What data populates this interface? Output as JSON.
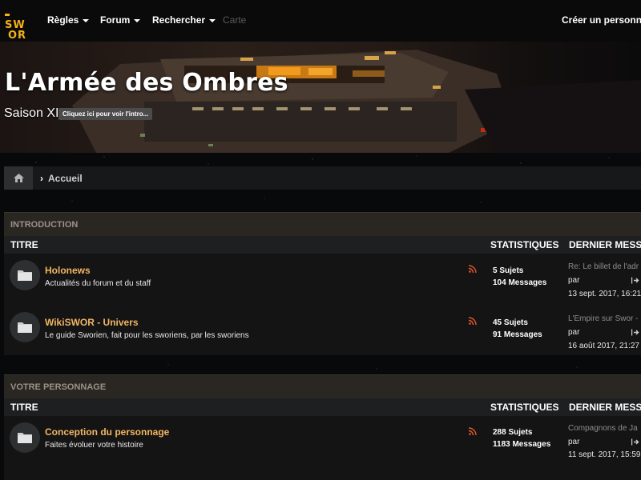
{
  "navbar": {
    "logo_line1": "SW",
    "logo_line2": "OR",
    "items": [
      {
        "label": "Règles"
      },
      {
        "label": "Forum"
      },
      {
        "label": "Rechercher"
      },
      {
        "label": "Carte"
      }
    ],
    "create_character": "Créer un personnage"
  },
  "banner": {
    "site_title": "L'Armée des Ombres",
    "season": "Saison XI",
    "intro_button": "Cliquez ici pour voir l'intro..."
  },
  "breadcrumb": {
    "home_icon": "home-icon",
    "items": [
      "Accueil"
    ]
  },
  "columns": {
    "title": "TITRE",
    "stats": "STATISTIQUES",
    "last": "DERNIER MESSA"
  },
  "categories": [
    {
      "name": "INTRODUCTION",
      "forums": [
        {
          "title": "Holonews",
          "description": "Actualités du forum et du staff",
          "topics": "5 Sujets",
          "messages": "104 Messages",
          "last_title": "Re: Le billet de l'adr",
          "last_by": "par",
          "last_date": "13 sept. 2017, 16:21"
        },
        {
          "title": "WikiSWOR - Univers",
          "description": "Le guide Sworien, fait pour les sworiens, par les sworiens",
          "topics": "45 Sujets",
          "messages": "91 Messages",
          "last_title": "L'Empire sur Swor -",
          "last_by": "par",
          "last_date": "16 août 2017, 21:27"
        }
      ]
    },
    {
      "name": "VOTRE PERSONNAGE",
      "forums": [
        {
          "title": "Conception du personnage",
          "description": "Faites évoluer votre histoire",
          "topics": "288 Sujets",
          "messages": "1183 Messages",
          "last_title": "Compagnons de Ja",
          "last_by": "par",
          "last_date": "11 sept. 2017, 15:59"
        }
      ]
    }
  ],
  "colors": {
    "accent": "#f5b01a",
    "forum_title": "#f3b563",
    "rss": "#e2572c",
    "category_header_bg": "#2a2723"
  }
}
